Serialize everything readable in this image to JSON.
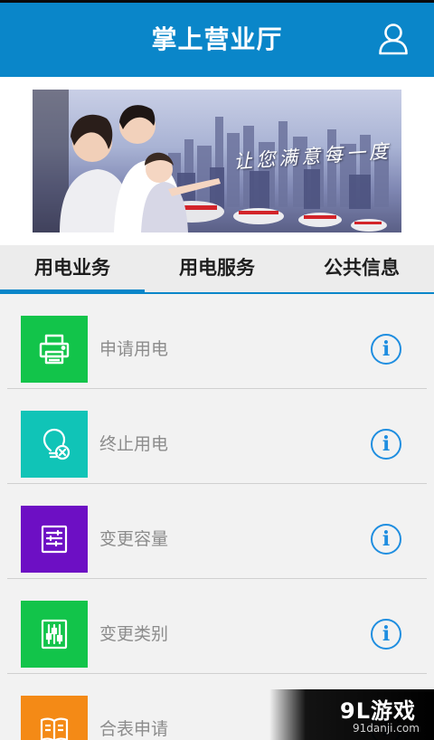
{
  "header": {
    "title": "掌上营业厅",
    "user_icon": "user-icon",
    "background": "#0a86c9"
  },
  "banner": {
    "slogan": "让您满意每一度"
  },
  "tabs": [
    {
      "label": "用电业务",
      "active": true
    },
    {
      "label": "用电服务",
      "active": false
    },
    {
      "label": "公共信息",
      "active": false
    }
  ],
  "items": [
    {
      "label": "申请用电",
      "icon": "printer-icon",
      "color": "#12c44a",
      "info": "i"
    },
    {
      "label": "终止用电",
      "icon": "lightbulb-cancel-icon",
      "color": "#10c4b7",
      "info": "i"
    },
    {
      "label": "变更容量",
      "icon": "document-list-icon",
      "color": "#6d0fc4",
      "info": "i"
    },
    {
      "label": "变更类别",
      "icon": "sliders-icon",
      "color": "#12c44a",
      "info": "i"
    },
    {
      "label": "合表申请",
      "icon": "book-icon",
      "color": "#f48a16",
      "info": "i"
    }
  ],
  "watermark": {
    "logo": "9L游戏",
    "url": "91danji.com"
  }
}
